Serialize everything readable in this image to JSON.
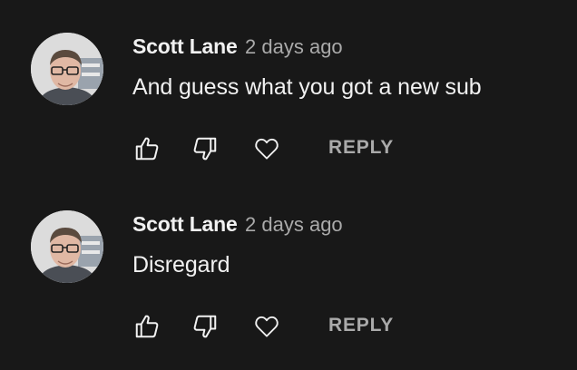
{
  "comments": [
    {
      "author": "Scott Lane",
      "time": "2 days ago",
      "text": "And guess what you got a new sub",
      "reply_label": "REPLY"
    },
    {
      "author": "Scott Lane",
      "time": "2 days ago",
      "text": "Disregard",
      "reply_label": "REPLY"
    }
  ],
  "icons": {
    "like": "thumbs-up-icon",
    "dislike": "thumbs-down-icon",
    "heart": "heart-icon"
  },
  "colors": {
    "background": "#181818",
    "text": "#f1f1f1",
    "secondary_text": "#aaaaaa"
  }
}
